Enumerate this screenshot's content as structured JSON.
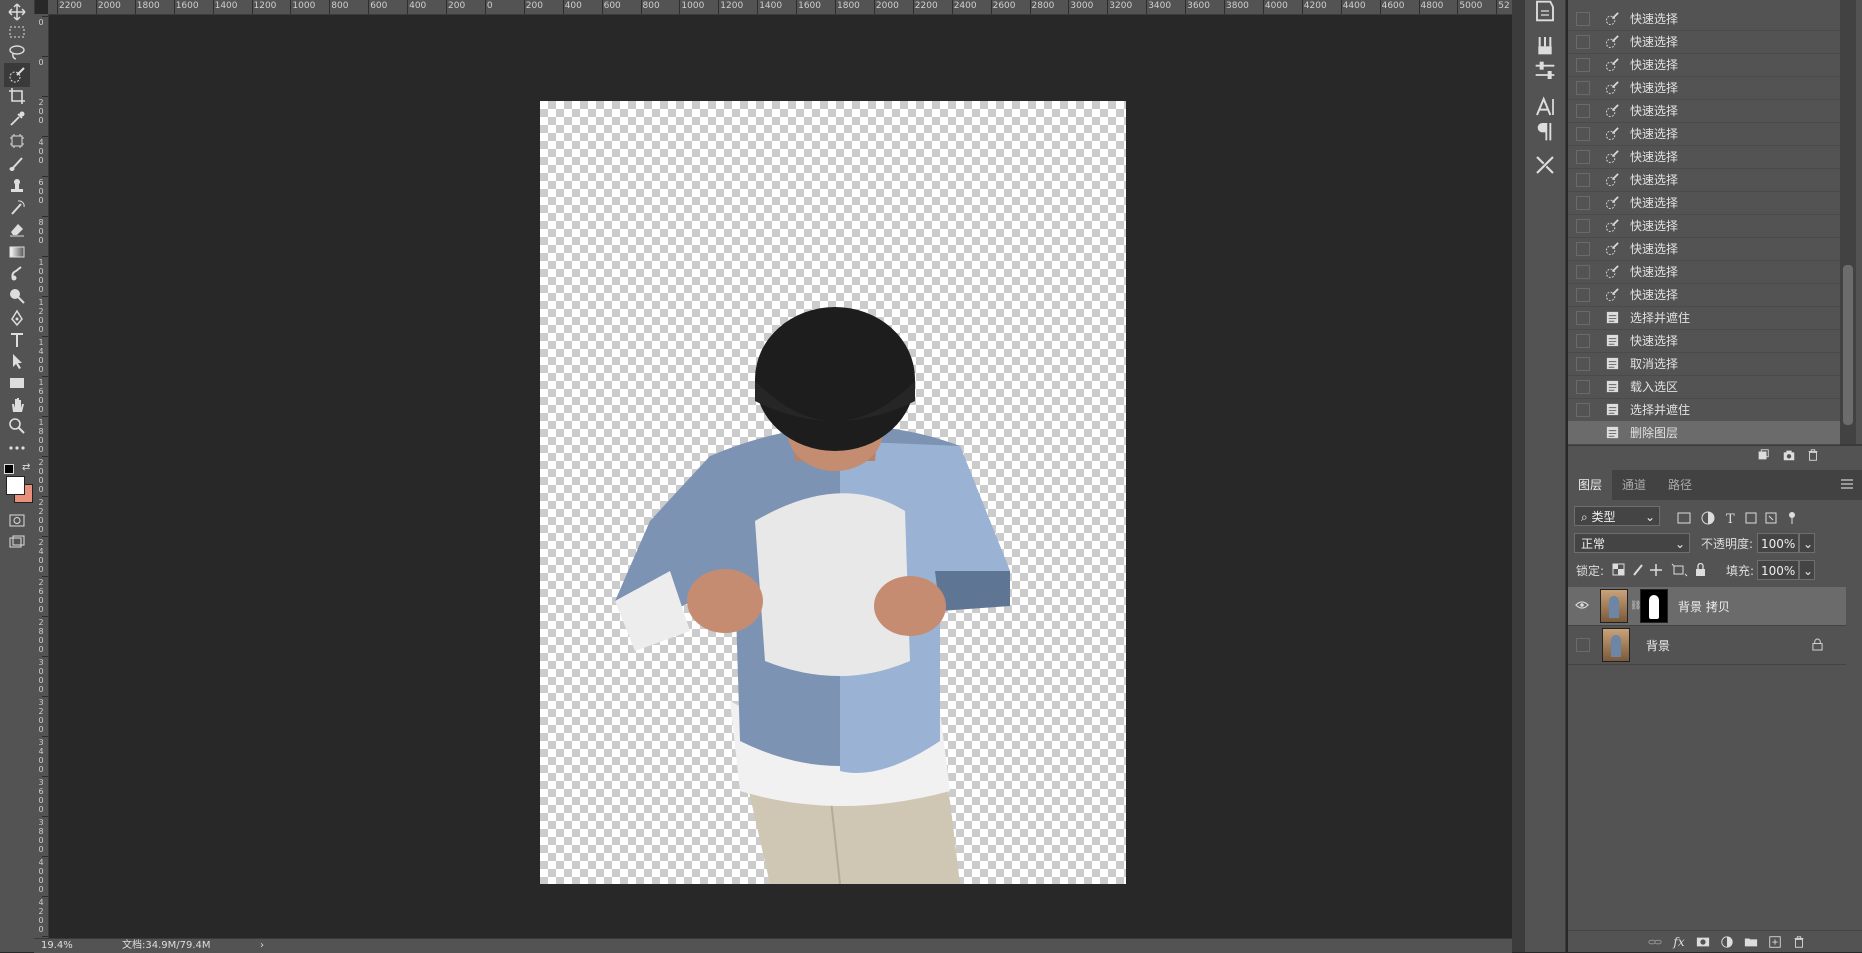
{
  "ruler": {
    "top_labels": [
      "2200",
      "2000",
      "1800",
      "1600",
      "1400",
      "1200",
      "1000",
      "800",
      "600",
      "400",
      "200",
      "0",
      "200",
      "400",
      "600",
      "800",
      "1000",
      "1200",
      "1400",
      "1600",
      "1800",
      "2000",
      "2200",
      "2400",
      "2600",
      "2800",
      "3000",
      "3200",
      "3400",
      "3600",
      "3800",
      "4000",
      "4200",
      "4400",
      "4600",
      "4800",
      "5000",
      "52"
    ],
    "left_labels": [
      "0",
      "0",
      "2\n0\n0",
      "4\n0\n0",
      "6\n0\n0",
      "8\n0\n0",
      "1\n0\n0\n0",
      "1\n2\n0\n0",
      "1\n4\n0\n0",
      "1\n6\n0\n0",
      "1\n8\n0\n0",
      "2\n0\n0\n0",
      "2\n2\n0\n0",
      "2\n4\n0\n0",
      "2\n6\n0\n0",
      "2\n8\n0\n0",
      "3\n0\n0\n0",
      "3\n2\n0\n0",
      "3\n4\n0\n0",
      "3\n6\n0\n0",
      "3\n8\n0\n0",
      "4\n0\n0\n0",
      "4\n2\n0\n0",
      "4\n4\n0\n0"
    ]
  },
  "toolbar": {
    "tools": [
      "move-tool-icon",
      "marquee-tool-icon",
      "lasso-tool-icon",
      "quick-select-tool-icon",
      "crop-tool-icon",
      "eyedropper-tool-icon",
      "frame-tool-icon",
      "brush-tool-icon",
      "stamp-tool-icon",
      "history-brush-icon",
      "eraser-tool-icon",
      "gradient-tool-icon",
      "smudge-tool-icon",
      "dodge-tool-icon",
      "pen-tool-icon",
      "type-tool-icon",
      "path-select-icon",
      "rectangle-tool-icon",
      "hand-tool-icon",
      "zoom-tool-icon",
      "more-tools-icon"
    ],
    "foreground_color": "#ffffff",
    "background_color": "#e8907c"
  },
  "status": {
    "zoom": "19.4%",
    "doc_size": "文档:34.9M/79.4M",
    "arrow": "›"
  },
  "history": {
    "items": [
      {
        "label": "快速选择",
        "icon": "quick-select"
      },
      {
        "label": "快速选择",
        "icon": "quick-select"
      },
      {
        "label": "快速选择",
        "icon": "quick-select"
      },
      {
        "label": "快速选择",
        "icon": "quick-select"
      },
      {
        "label": "快速选择",
        "icon": "quick-select"
      },
      {
        "label": "快速选择",
        "icon": "quick-select"
      },
      {
        "label": "快速选择",
        "icon": "quick-select"
      },
      {
        "label": "快速选择",
        "icon": "quick-select"
      },
      {
        "label": "快速选择",
        "icon": "quick-select"
      },
      {
        "label": "快速选择",
        "icon": "quick-select"
      },
      {
        "label": "快速选择",
        "icon": "quick-select"
      },
      {
        "label": "快速选择",
        "icon": "quick-select"
      },
      {
        "label": "快速选择",
        "icon": "quick-select"
      },
      {
        "label": "选择并遮住",
        "icon": "document"
      },
      {
        "label": "快速选择",
        "icon": "document"
      },
      {
        "label": "取消选择",
        "icon": "document"
      },
      {
        "label": "载入选区",
        "icon": "document"
      },
      {
        "label": "选择并遮住",
        "icon": "document"
      },
      {
        "label": "删除图层",
        "icon": "document",
        "active": true
      }
    ]
  },
  "layers_panel": {
    "tabs": [
      "图层",
      "通道",
      "路径"
    ],
    "filter_label": "类型",
    "blend_mode": "正常",
    "opacity_label": "不透明度:",
    "opacity_value": "100%",
    "lock_label": "锁定:",
    "fill_label": "填充:",
    "fill_value": "100%",
    "layers": [
      {
        "name": "背景 拷贝",
        "visible": true,
        "has_mask": true,
        "active": true
      },
      {
        "name": "背景",
        "visible": false,
        "locked": true
      }
    ],
    "footer_icons": [
      "link-icon",
      "fx-icon",
      "mask-icon",
      "adjustment-icon",
      "group-icon",
      "new-layer-icon",
      "trash-icon"
    ]
  }
}
